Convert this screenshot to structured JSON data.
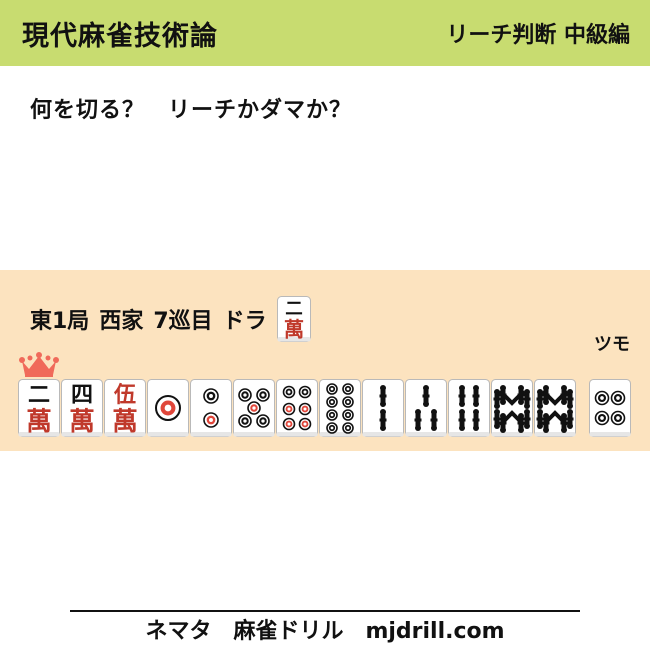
{
  "header": {
    "title": "現代麻雀技術論",
    "subtitle": "リーチ判断 中級編",
    "bg_color": "#c8dc70"
  },
  "question": "何を切る？　リーチかダマか？",
  "situation": {
    "round": "東1局",
    "seat": "西家",
    "turn": "7巡目",
    "dora_label": "ドラ",
    "dora_tile": {
      "suit": "man",
      "rank": 2,
      "glyph": "二"
    },
    "panel_color": "#fce3bf"
  },
  "tsumo_label": "ツモ",
  "crown_icon": "crown-icon",
  "hand": [
    {
      "suit": "man",
      "rank": 2,
      "glyph": "二"
    },
    {
      "suit": "man",
      "rank": 4,
      "glyph": "四"
    },
    {
      "suit": "man",
      "rank": 5,
      "glyph": "伍",
      "red": true
    },
    {
      "suit": "pin",
      "rank": 1
    },
    {
      "suit": "pin",
      "rank": 2
    },
    {
      "suit": "pin",
      "rank": 5
    },
    {
      "suit": "pin",
      "rank": 6
    },
    {
      "suit": "pin",
      "rank": 8
    },
    {
      "suit": "sou",
      "rank": 2
    },
    {
      "suit": "sou",
      "rank": 3
    },
    {
      "suit": "sou",
      "rank": 4
    },
    {
      "suit": "sou",
      "rank": 8
    },
    {
      "suit": "sou",
      "rank": 8
    }
  ],
  "tsumo_tile": {
    "suit": "pin",
    "rank": 4
  },
  "man_char": "萬",
  "footer": "ネマタ　麻雀ドリル　mjdrill.com"
}
